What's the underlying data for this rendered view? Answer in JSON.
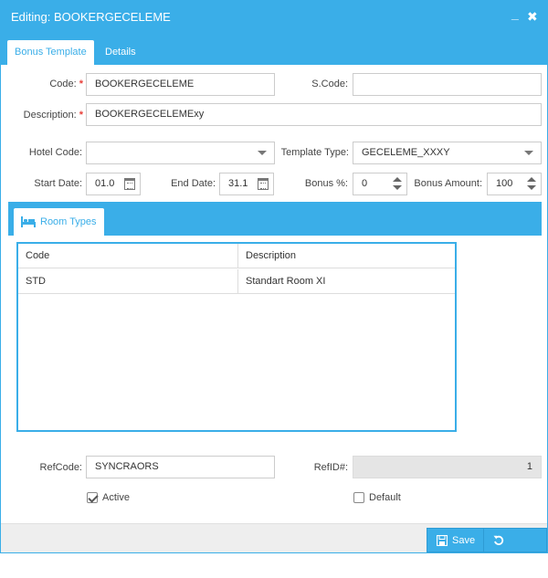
{
  "window": {
    "title": "Editing: BOOKERGECELEME",
    "minimize": "_",
    "close": "✖"
  },
  "tabs": [
    {
      "label": "Bonus Template"
    },
    {
      "label": "Details"
    }
  ],
  "form": {
    "code": {
      "label": "Code:",
      "value": "BOOKERGECELEME"
    },
    "scode": {
      "label": "S.Code:",
      "value": ""
    },
    "description": {
      "label": "Description:",
      "value": "BOOKERGECELEMExy"
    },
    "required_mark": "*",
    "hotel_code": {
      "label": "Hotel Code:",
      "value": ""
    },
    "template_type": {
      "label": "Template Type:",
      "value": "GECELEME_XXXY"
    },
    "start_date": {
      "label": "Start Date:",
      "value": "01.0"
    },
    "end_date": {
      "label": "End Date:",
      "value": "31.1"
    },
    "bonus_pct": {
      "label": "Bonus %:",
      "value": "0"
    },
    "bonus_amount": {
      "label": "Bonus Amount:",
      "value": "100"
    }
  },
  "room_types": {
    "tab_label": "Room Types",
    "columns": [
      "Code",
      "Description"
    ],
    "rows": [
      {
        "code": "STD",
        "description": "Standart Room XI"
      }
    ]
  },
  "bottom": {
    "refcode": {
      "label": "RefCode:",
      "value": "SYNCRAORS"
    },
    "refid": {
      "label": "RefID#:",
      "value": "1"
    },
    "active": {
      "label": "Active",
      "checked": true
    },
    "default": {
      "label": "Default",
      "checked": false
    }
  },
  "buttons": {
    "save": "Save",
    "cancel": "Cancel"
  },
  "colors": {
    "accent": "#3aaee8",
    "required": "#e8403a",
    "footer": "#eeeeee"
  }
}
